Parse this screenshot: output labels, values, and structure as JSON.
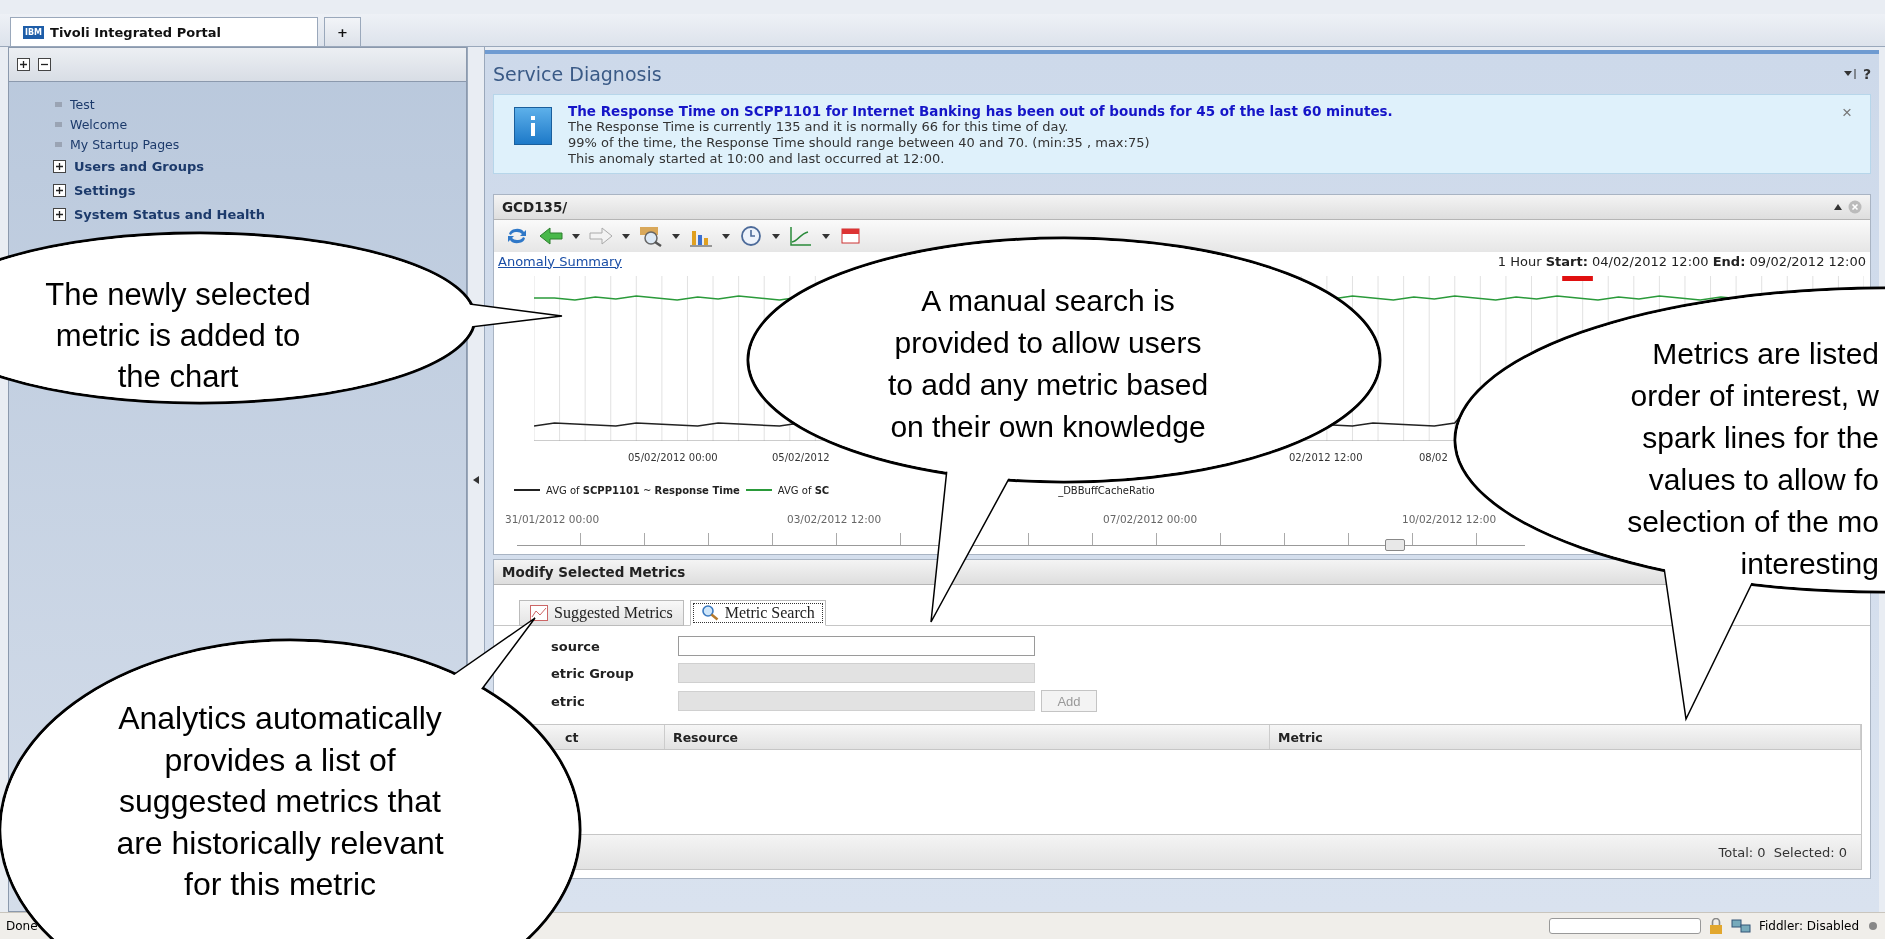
{
  "browser_tabs": [
    {
      "label": "Tivoli Integrated Portal",
      "badge": "IBM",
      "selected": true
    },
    {
      "label": "+",
      "selected": false
    }
  ],
  "sidebar": {
    "items": [
      {
        "label": "Test",
        "kind": "page"
      },
      {
        "label": "Welcome",
        "kind": "page"
      },
      {
        "label": "My Startup Pages",
        "kind": "page"
      },
      {
        "label": "Users and Groups",
        "kind": "folder",
        "expanded": false
      },
      {
        "label": "Settings",
        "kind": "folder",
        "expanded": false
      },
      {
        "label": "System Status and Health",
        "kind": "folder",
        "expanded": false
      }
    ]
  },
  "page": {
    "title": "Service Diagnosis",
    "help": "?"
  },
  "alert": {
    "headline": "The Response Time on SCPP1101 for Internet Banking has been out of bounds for 45 of the last 60 minutes.",
    "lines": [
      "The Response Time is currently 135 and it is normally 66 for this time of day.",
      "99% of the time, the Response Time should range between 40 and 70. (min:35 , max:75)",
      "This anomaly started at 10:00 and last occurred at 12:00."
    ],
    "close": "×"
  },
  "chart_panel": {
    "title": "GCD135/",
    "link": "Anomaly Summary",
    "range": "1 Hour  **Start:** 04/02/2012 12:00  **End:** 09/02/2012 12:00",
    "x_labels": [
      "05/02/2012 00:00",
      "05/02/2012",
      "02/2012 12:00",
      "08/02"
    ],
    "legend": [
      {
        "text": "AVG of **SCPP1101** ~ **Response Time**",
        "color": "#222222"
      },
      {
        "text": "AVG of **SC**",
        "color": "#2a9a3a"
      }
    ],
    "legend_tail": "_DBBuffCacheRatio",
    "timeline_labels": [
      "31/01/2012 00:00",
      "03/02/2012 12:00",
      "07/02/2012 00:00",
      "10/02/2012 12:00"
    ],
    "level": 0.87
  },
  "metrics_panel": {
    "title": "Modify Selected Metrics",
    "tabs": [
      {
        "label": "Suggested Metrics",
        "selected": false
      },
      {
        "label": "Metric Search",
        "selected": true
      }
    ],
    "fields": [
      {
        "label": "source",
        "disabled": false
      },
      {
        "label": "etric Group",
        "disabled": true
      },
      {
        "label": "etric",
        "disabled": true
      }
    ],
    "add_button": {
      "label": "Add",
      "disabled": true
    },
    "columns": [
      "ct",
      "Resource",
      "Metric"
    ],
    "footer": "Total: 0  Selected: 0"
  },
  "status_bar": {
    "text": "Done",
    "fiddler": "Fiddler: Disabled"
  },
  "callouts": [
    {
      "lines": [
        "The newly selected",
        "metric is added to",
        "the chart"
      ]
    },
    {
      "lines": [
        "A manual search is",
        "provided to allow users",
        "to add any metric based",
        "on their own knowledge"
      ]
    },
    {
      "lines": [
        "Metrics are listed",
        "order of interest, w",
        "spark lines for the",
        "values to allow fo",
        "selection of the mo",
        "interesting"
      ]
    },
    {
      "lines": [
        "Analytics automatically",
        "provides a list of",
        "suggested metrics that",
        "are historically relevant",
        "for this metric"
      ]
    }
  ]
}
